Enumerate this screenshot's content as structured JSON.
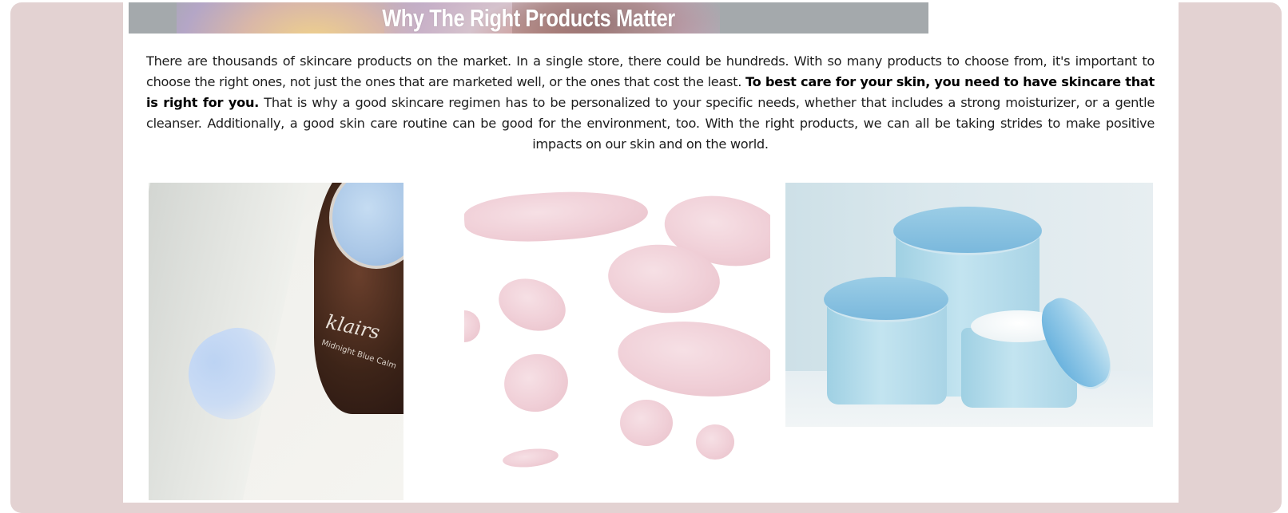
{
  "section": {
    "title": "Why The Right Products Matter",
    "paragraph_part1": "There are thousands of skincare products on the market. In a single store, there could be hundreds. With so many products to choose from, it's important to choose the right ones, not just the ones that are marketed well, or the ones that cost the least. ",
    "paragraph_bold": "To best care for your skin, you need to have skincare that is right for you.",
    "paragraph_part2": " That is why a good skincare regimen has to be personalized to your specific needs, whether that includes a strong moisturizer, or a gentle cleanser. Additionally, a good skin care routine can be good for the environment, too. With the right products, we can all be taking strides to make positive impacts on our skin and on the world."
  },
  "images": {
    "photo1": {
      "brand_text": "klairs",
      "sub_text": "Midnight Blue Calm"
    }
  },
  "colors": {
    "page_frame": "#e3d2d2",
    "panel": "#ffffff",
    "banner": "#a4a9ac",
    "text": "#1d1d1d"
  }
}
